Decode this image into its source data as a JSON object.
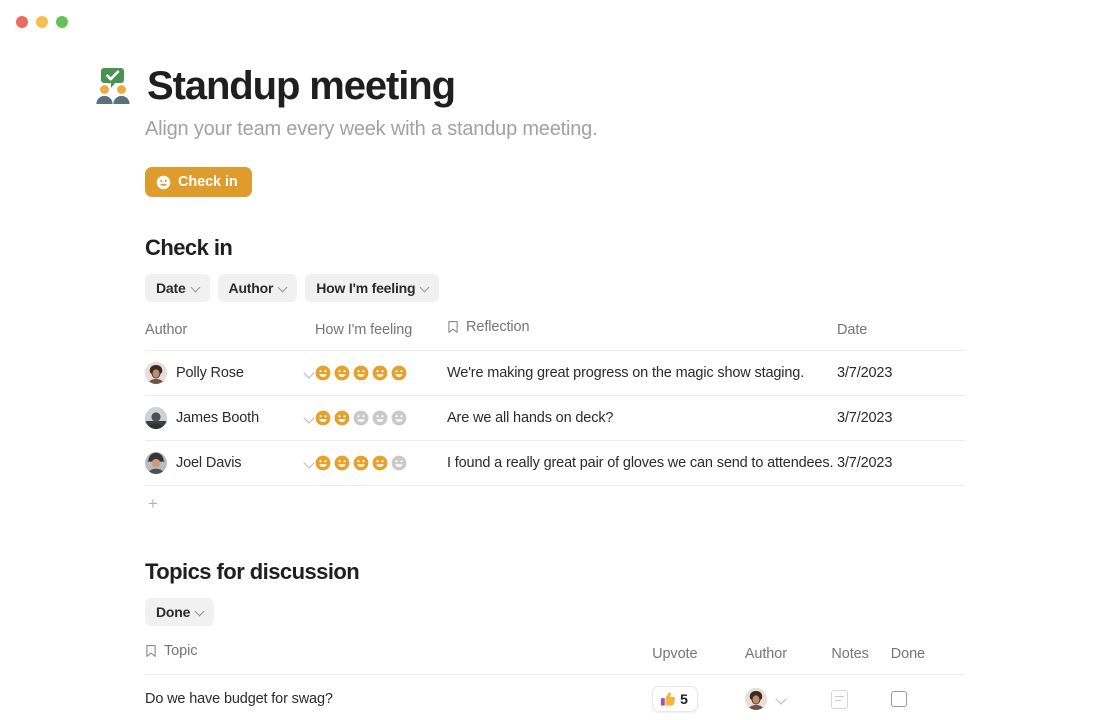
{
  "window": {
    "traffic_lights": [
      {
        "name": "close",
        "color": "#ed6a5e"
      },
      {
        "name": "minimize",
        "color": "#f5bf4f"
      },
      {
        "name": "zoom",
        "color": "#61c454"
      }
    ]
  },
  "doc": {
    "icon": "people-speech-check-icon",
    "title": "Standup meeting",
    "subtitle": "Align your team every week with a standup meeting."
  },
  "primary_action": {
    "icon": "smiley-icon",
    "label": "Check in",
    "color": "#dd9c2c"
  },
  "checkin_section": {
    "title": "Check in",
    "filters": [
      {
        "label": "Date",
        "icon": "chevron-down-icon"
      },
      {
        "label": "Author",
        "icon": "chevron-down-icon"
      },
      {
        "label": "How I'm feeling",
        "icon": "chevron-down-icon"
      }
    ],
    "columns": [
      {
        "label": "Author",
        "icon": null
      },
      {
        "label": "How I'm feeling",
        "icon": null
      },
      {
        "label": "Reflection",
        "icon": "bookmark-icon"
      },
      {
        "label": "Date",
        "icon": null
      }
    ],
    "rows": [
      {
        "author": "Polly Rose",
        "avatar": "avatar-polly-rose",
        "feeling_rating": 5,
        "feeling_max": 5,
        "reflection": "We're making great progress on the magic show staging.",
        "date": "3/7/2023"
      },
      {
        "author": "James Booth",
        "avatar": "avatar-james-booth",
        "feeling_rating": 2,
        "feeling_max": 5,
        "reflection": "Are we all hands on deck?",
        "date": "3/7/2023"
      },
      {
        "author": "Joel Davis",
        "avatar": "avatar-joel-davis",
        "feeling_rating": 4,
        "feeling_max": 5,
        "reflection": "I found a really great pair of gloves we can send to attendees.",
        "date": "3/7/2023"
      }
    ],
    "add_row_label": "+"
  },
  "topics_section": {
    "title": "Topics for discussion",
    "filters": [
      {
        "label": "Done",
        "icon": "chevron-down-icon"
      }
    ],
    "columns": [
      {
        "label": "Topic",
        "icon": "bookmark-icon"
      },
      {
        "label": "Upvote",
        "icon": null
      },
      {
        "label": "Author",
        "icon": null
      },
      {
        "label": "Notes",
        "icon": null
      },
      {
        "label": "Done",
        "icon": null
      }
    ],
    "rows": [
      {
        "topic": "Do we have budget for swag?",
        "upvote_icon": "thumbs-up-icon",
        "upvote_count": "5",
        "avatar": "avatar-polly-rose",
        "notes_icon": "notes-document-icon",
        "done": false
      }
    ]
  },
  "colors": {
    "accent": "#dd9c2c",
    "smiley_filled": "#e4a12c",
    "smiley_empty": "#c9c9cb",
    "text_primary": "#1f1f1f",
    "text_muted": "#76767a",
    "rule": "#ececec"
  }
}
